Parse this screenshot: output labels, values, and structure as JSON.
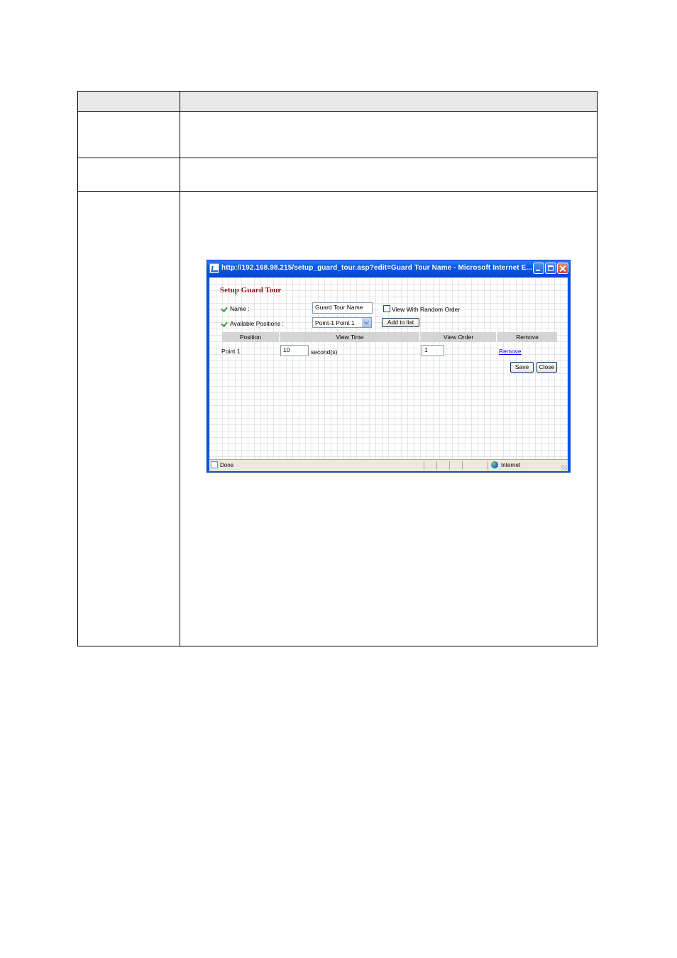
{
  "window": {
    "title": "http://192.168.98.215/setup_guard_tour.asp?edit=Guard Tour Name - Microsoft Internet E...",
    "icon": "ie-page-icon"
  },
  "form": {
    "heading": "Setup Guard Tour",
    "name_label": "Name :",
    "name_value": "Guard Tour Name",
    "random_order_label": "View With Random Order",
    "random_order_checked": false,
    "positions_label": "Available Positions :",
    "positions_selected": "Point-1  Point 1",
    "add_button": "Add to list"
  },
  "grid": {
    "columns": [
      "Position",
      "View Time",
      "View Order",
      "Remove"
    ],
    "rows": [
      {
        "position": "Point 1",
        "view_time": "10",
        "unit": "second(s)",
        "view_order": "1",
        "remove": "Remove"
      }
    ]
  },
  "actions": {
    "save": "Save",
    "close": "Close"
  },
  "status": {
    "text": "Done",
    "zone": "Internet"
  },
  "colors": {
    "titlebar": "#0a57e0",
    "heading": "#8b1a1a",
    "link": "#0000ee"
  }
}
